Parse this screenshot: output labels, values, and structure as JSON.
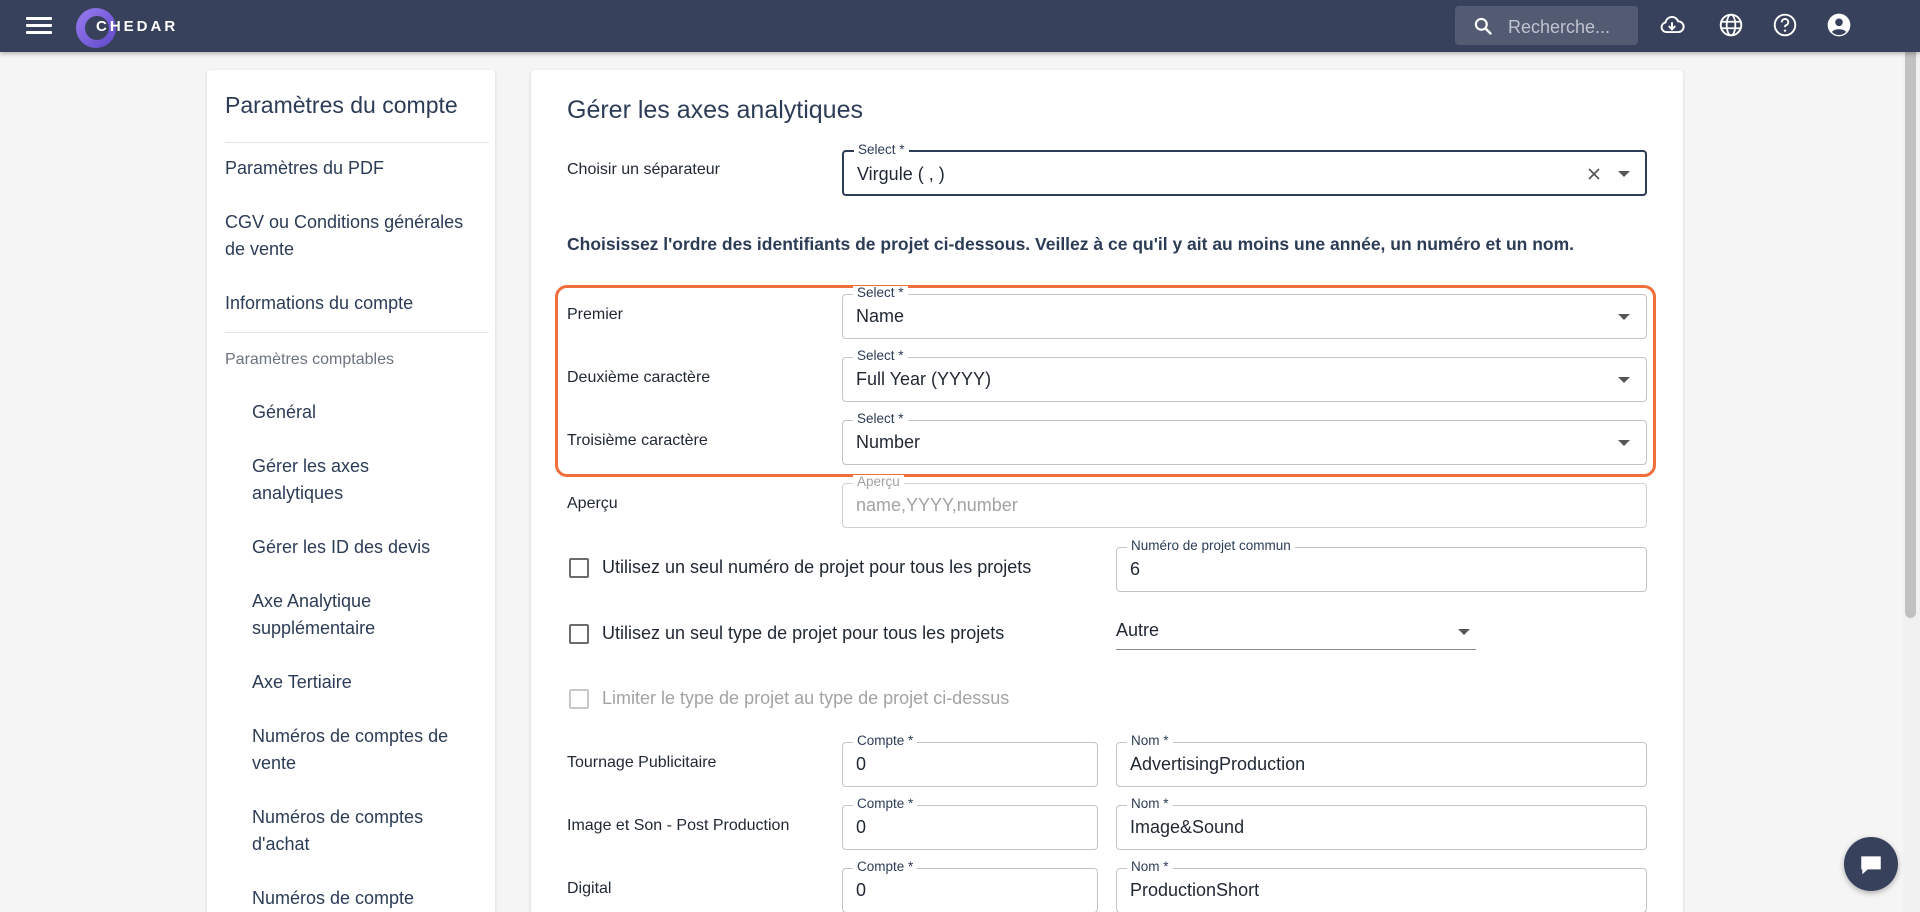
{
  "header": {
    "logo_text": "CHEDAR",
    "search_placeholder": "Recherche..."
  },
  "sidebar": {
    "title": "Paramètres du compte",
    "items_top": [
      "Paramètres du PDF",
      "CGV ou Conditions générales de vente",
      "Informations du compte"
    ],
    "section_label": "Paramètres comptables",
    "sub_items": [
      "Général",
      "Gérer les axes analytiques",
      "Gérer les ID des devis",
      "Axe Analytique supplémentaire",
      "Axe Tertiaire",
      "Numéros de comptes de vente",
      "Numéros de comptes d'achat",
      "Numéros de compte"
    ]
  },
  "main": {
    "title": "Gérer les axes analytiques",
    "separator": {
      "label": "Choisir un séparateur",
      "legend": "Select *",
      "value": "Virgule ( , )"
    },
    "instruction": "Choisissez l'ordre des identifiants de projet ci-dessous. Veillez à ce qu'il y ait au moins une année, un numéro et un nom.",
    "order_rows": [
      {
        "label": "Premier",
        "legend": "Select *",
        "value": "Name"
      },
      {
        "label": "Deuxième caractère",
        "legend": "Select *",
        "value": "Full Year (YYYY)"
      },
      {
        "label": "Troisième caractère",
        "legend": "Select *",
        "value": "Number"
      }
    ],
    "preview": {
      "label": "Aperçu",
      "legend": "Aperçu",
      "value": "name,YYYY,number"
    },
    "single_number": {
      "label": "Utilisez un seul numéro de projet pour tous les projets",
      "checked": false,
      "field_legend": "Numéro de projet commun",
      "field_value": "6"
    },
    "single_type": {
      "label": "Utilisez un seul type de projet pour tous les projets",
      "checked": false,
      "select_value": "Autre"
    },
    "limit_type": {
      "label": "Limiter le type de projet au type de projet ci-dessus",
      "checked": false,
      "disabled": true
    },
    "project_types": [
      {
        "label": "Tournage Publicitaire",
        "compte_legend": "Compte *",
        "compte": "0",
        "nom_legend": "Nom *",
        "nom": "AdvertisingProduction"
      },
      {
        "label": "Image et Son - Post Production",
        "compte_legend": "Compte *",
        "compte": "0",
        "nom_legend": "Nom *",
        "nom": "Image&Sound"
      },
      {
        "label": "Digital",
        "compte_legend": "Compte *",
        "compte": "0",
        "nom_legend": "Nom *",
        "nom": "ProductionShort"
      }
    ]
  },
  "colors": {
    "topbar": "#38415c",
    "highlight": "#f06e3c",
    "text_dark": "#2c3c56"
  }
}
